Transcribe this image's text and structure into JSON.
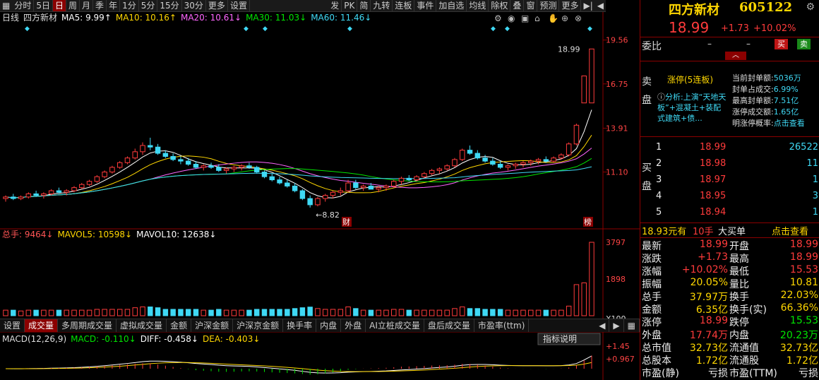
{
  "toolbar": {
    "items": [
      "分时",
      "5日",
      "日",
      "周",
      "月",
      "季",
      "年",
      "1分",
      "5分",
      "15分",
      "30分",
      "更多",
      "设置"
    ],
    "selected": 2,
    "right": [
      "发",
      "PK",
      "简",
      "九转",
      "连板",
      "事件",
      "加自选",
      "均线",
      "除权",
      "叠",
      "窗",
      "预测",
      "更多"
    ]
  },
  "ma": {
    "period": "日线",
    "name": "四方新材",
    "items": [
      {
        "label": "MA5: 9.99",
        "color": "#ffffff"
      },
      {
        "label": "MA10: 10.16",
        "color": "#ffd700"
      },
      {
        "label": "MA20: 10.61",
        "color": "#ff66ff"
      },
      {
        "label": "MA30: 11.03",
        "color": "#00e600"
      },
      {
        "label": "MA60: 11.46",
        "color": "#3fd9f5"
      }
    ]
  },
  "price_axis": {
    "labels": [
      "19.56",
      "16.75",
      "13.91",
      "11.10"
    ],
    "high_label": "18.99",
    "low_label": "8.82",
    "cai": "财",
    "bang": "榜"
  },
  "vol_header": {
    "items": [
      {
        "label": "总手: 9464",
        "color": "#ff5555"
      },
      {
        "label": "MAVOL5: 10598",
        "color": "#ffd700"
      },
      {
        "label": "MAVOL10: 12638",
        "color": "#ffffff"
      }
    ]
  },
  "vol_axis": {
    "labels": [
      "3797",
      "1898",
      "X100"
    ]
  },
  "tabs": {
    "items": [
      "设置",
      "成交量",
      "多周期成交量",
      "虚拟成交量",
      "金额",
      "沪深金额",
      "沪深京金额",
      "换手率",
      "内盘",
      "外盘",
      "AI立桩成交量",
      "盘后成交量",
      "市盈率(ttm)"
    ],
    "selected": 1
  },
  "macd_header": {
    "items": [
      {
        "label": "MACD(12,26,9)",
        "color": "#dddddd"
      },
      {
        "label": "MACD: -0.110",
        "color": "#00e600"
      },
      {
        "label": "DIFF: -0.458",
        "color": "#ffffff"
      },
      {
        "label": "DEA: -0.403",
        "color": "#ffd700"
      }
    ],
    "help": "指标说明"
  },
  "macd_axis": {
    "labels": [
      "+1.45",
      "+0.967"
    ]
  },
  "stock": {
    "name": "四方新材",
    "code": "605122",
    "price": "18.99",
    "change": "+1.73",
    "pct": "+10.02%"
  },
  "weibi": {
    "label": "委比",
    "v1": "–",
    "v2": "–",
    "buy": "买",
    "sell": "卖"
  },
  "sell_side": {
    "label": "卖盘"
  },
  "limitup": {
    "title": "涨停(5连板)",
    "analysis": "分析:上演“天地天板”+混凝土+装配式建筑+债...",
    "fields": [
      {
        "k": "当前封单额:",
        "v": "5036万"
      },
      {
        "k": "封单占成交:",
        "v": "6.99%"
      },
      {
        "k": "最高封单额:",
        "v": "7.51亿"
      },
      {
        "k": "涨停成交额:",
        "v": "1.65亿"
      },
      {
        "k": "明涨停概率:",
        "v": "点击查看"
      }
    ]
  },
  "buy_side": {
    "label": "买盘",
    "rows": [
      {
        "lvl": "1",
        "price": "18.99",
        "vol": "26522"
      },
      {
        "lvl": "2",
        "price": "18.98",
        "vol": "11"
      },
      {
        "lvl": "3",
        "price": "18.97",
        "vol": "1"
      },
      {
        "lvl": "4",
        "price": "18.95",
        "vol": "3"
      },
      {
        "lvl": "5",
        "price": "18.94",
        "vol": "1"
      }
    ]
  },
  "bigorder": {
    "price": "18.93元有",
    "qty": "10手",
    "label": "大买单",
    "link": "点击查看"
  },
  "quotes": [
    {
      "k1": "最新",
      "v1": "18.99",
      "c1": "r",
      "k2": "开盘",
      "v2": "18.99",
      "c2": "r"
    },
    {
      "k1": "涨跌",
      "v1": "+1.73",
      "c1": "r",
      "k2": "最高",
      "v2": "18.99",
      "c2": "r"
    },
    {
      "k1": "涨幅",
      "v1": "+10.02%",
      "c1": "r",
      "k2": "最低",
      "v2": "15.53",
      "c2": "r"
    },
    {
      "k1": "振幅",
      "v1": "20.05%",
      "c1": "y",
      "k2": "量比",
      "v2": "10.81",
      "c2": "y"
    },
    {
      "k1": "总手",
      "v1": "37.97万",
      "c1": "y",
      "k2": "换手",
      "v2": "22.03%",
      "c2": "y"
    },
    {
      "k1": "金额",
      "v1": "6.35亿",
      "c1": "y",
      "k2": "换手(实)",
      "v2": "66.36%",
      "c2": "y"
    },
    {
      "k1": "涨停",
      "v1": "18.99",
      "c1": "r",
      "k2": "跌停",
      "v2": "15.53",
      "c2": "g"
    },
    {
      "k1": "外盘",
      "v1": "17.74万",
      "c1": "r",
      "k2": "内盘",
      "v2": "20.23万",
      "c2": "g"
    },
    {
      "k1": "总市值",
      "v1": "32.73亿",
      "c1": "y",
      "k2": "流通值",
      "v2": "32.73亿",
      "c2": "y"
    },
    {
      "k1": "总股本",
      "v1": "1.72亿",
      "c1": "y",
      "k2": "流通股",
      "v2": "1.72亿",
      "c2": "y"
    },
    {
      "k1": "市盈(静)",
      "v1": "亏损",
      "c1": "w",
      "k2": "市盈(TTM)",
      "v2": "亏损",
      "c2": "w"
    }
  ],
  "chart_data": {
    "type": "candlestick",
    "ohlc_approx": [
      [
        9.4,
        9.6,
        9.2,
        9.5
      ],
      [
        9.5,
        9.7,
        9.3,
        9.4
      ],
      [
        9.4,
        9.6,
        9.3,
        9.5
      ],
      [
        9.5,
        9.8,
        9.4,
        9.7
      ],
      [
        9.7,
        9.9,
        9.5,
        9.6
      ],
      [
        9.6,
        9.8,
        9.4,
        9.7
      ],
      [
        9.7,
        10.0,
        9.6,
        9.9
      ],
      [
        9.9,
        10.1,
        9.7,
        9.8
      ],
      [
        9.8,
        10.0,
        9.6,
        9.9
      ],
      [
        9.9,
        10.2,
        9.8,
        10.1
      ],
      [
        10.1,
        10.4,
        10.0,
        10.3
      ],
      [
        10.3,
        10.6,
        10.2,
        10.5
      ],
      [
        10.5,
        10.9,
        10.4,
        10.8
      ],
      [
        10.8,
        11.2,
        10.7,
        11.1
      ],
      [
        11.1,
        11.5,
        11.0,
        11.4
      ],
      [
        11.4,
        11.8,
        11.3,
        11.7
      ],
      [
        11.7,
        12.1,
        11.6,
        12.0
      ],
      [
        12.0,
        12.6,
        11.9,
        12.4
      ],
      [
        12.4,
        13.0,
        12.2,
        12.8
      ],
      [
        12.8,
        13.3,
        12.5,
        12.7
      ],
      [
        12.7,
        12.9,
        12.2,
        12.3
      ],
      [
        12.3,
        12.5,
        12.0,
        12.1
      ],
      [
        12.1,
        12.3,
        11.8,
        11.9
      ],
      [
        11.9,
        12.1,
        11.6,
        11.8
      ],
      [
        11.8,
        12.0,
        11.5,
        11.6
      ],
      [
        11.6,
        11.8,
        11.3,
        11.4
      ],
      [
        11.4,
        11.6,
        11.2,
        11.5
      ],
      [
        11.5,
        11.7,
        11.3,
        11.4
      ],
      [
        11.4,
        11.6,
        11.1,
        11.2
      ],
      [
        11.2,
        11.4,
        11.0,
        11.3
      ],
      [
        11.3,
        11.5,
        11.1,
        11.4
      ],
      [
        11.4,
        11.6,
        11.2,
        11.5
      ],
      [
        11.5,
        11.7,
        11.3,
        11.4
      ],
      [
        11.4,
        11.5,
        11.0,
        11.1
      ],
      [
        11.1,
        11.2,
        10.7,
        10.8
      ],
      [
        10.8,
        11.0,
        10.5,
        10.6
      ],
      [
        10.6,
        10.8,
        10.3,
        10.4
      ],
      [
        10.4,
        10.6,
        10.1,
        10.2
      ],
      [
        10.2,
        10.4,
        9.8,
        9.9
      ],
      [
        9.9,
        10.0,
        9.3,
        9.4
      ],
      [
        9.4,
        9.6,
        8.82,
        9.0
      ],
      [
        9.0,
        9.5,
        8.9,
        9.4
      ],
      [
        9.4,
        9.7,
        9.2,
        9.6
      ],
      [
        9.6,
        9.9,
        9.4,
        9.8
      ],
      [
        9.8,
        10.1,
        9.6,
        9.9
      ],
      [
        9.9,
        10.6,
        9.8,
        10.4
      ],
      [
        10.4,
        10.6,
        10.0,
        10.1
      ],
      [
        10.1,
        10.3,
        9.9,
        10.2
      ],
      [
        10.2,
        10.4,
        10.0,
        10.0
      ],
      [
        10.0,
        10.2,
        9.8,
        10.1
      ],
      [
        10.1,
        10.3,
        9.9,
        10.2
      ],
      [
        10.2,
        10.6,
        10.1,
        10.5
      ],
      [
        10.5,
        10.8,
        10.3,
        10.7
      ],
      [
        10.7,
        10.9,
        10.5,
        10.6
      ],
      [
        10.6,
        10.9,
        10.5,
        10.8
      ],
      [
        10.8,
        11.1,
        10.7,
        11.0
      ],
      [
        11.0,
        11.3,
        10.9,
        11.2
      ],
      [
        11.2,
        11.4,
        11.0,
        11.3
      ],
      [
        11.3,
        11.6,
        11.2,
        11.5
      ],
      [
        11.5,
        12.0,
        11.4,
        11.9
      ],
      [
        11.9,
        12.6,
        11.8,
        12.5
      ],
      [
        12.5,
        12.8,
        12.2,
        12.3
      ],
      [
        12.3,
        12.5,
        11.9,
        12.0
      ],
      [
        12.0,
        12.2,
        11.7,
        11.8
      ],
      [
        11.8,
        12.0,
        11.5,
        11.6
      ],
      [
        11.6,
        11.8,
        11.3,
        11.4
      ],
      [
        11.4,
        11.6,
        11.2,
        11.5
      ],
      [
        11.5,
        11.7,
        11.3,
        11.6
      ],
      [
        11.6,
        11.8,
        11.4,
        11.7
      ],
      [
        11.7,
        11.9,
        11.5,
        11.8
      ],
      [
        11.8,
        12.0,
        11.6,
        11.9
      ],
      [
        11.9,
        12.1,
        11.7,
        11.8
      ],
      [
        11.8,
        12.1,
        11.7,
        12.0
      ],
      [
        12.0,
        12.3,
        11.9,
        12.2
      ],
      [
        12.2,
        13.0,
        12.1,
        12.9
      ],
      [
        12.9,
        14.2,
        12.8,
        14.1
      ],
      [
        15.53,
        17.26,
        15.53,
        17.26
      ],
      [
        15.53,
        18.99,
        15.53,
        18.99
      ]
    ],
    "ylim": [
      8.0,
      20.0
    ],
    "volume_last": 3797
  }
}
